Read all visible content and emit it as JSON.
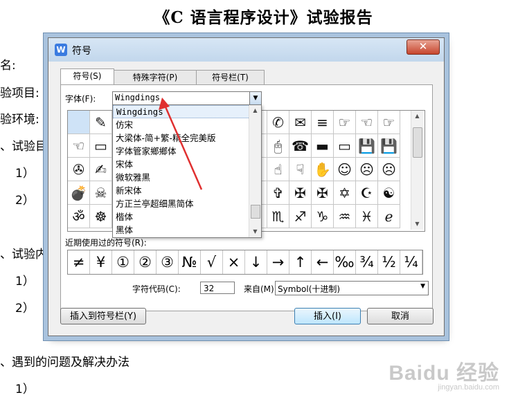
{
  "document": {
    "title": "《C 语言程序设计》试验报告",
    "lines": [
      "名:",
      "验项目:",
      "验环境:",
      "、试验目",
      "1）",
      "2）",
      "、试验内",
      "1）",
      "2）",
      "、遇到的问题及解决办法",
      "1）"
    ]
  },
  "watermark": {
    "main": "Baidu 经验",
    "sub": "jingyan.baidu.com"
  },
  "dialog": {
    "app_icon": "W",
    "title": "符号",
    "close_label": "✕",
    "tabs": [
      "符号(S)",
      "特殊字符(P)",
      "符号栏(T)"
    ],
    "font_label": "字体(F):",
    "font_value": "Wingdings",
    "font_options": [
      "Wingdings",
      "仿宋",
      "大梁体-简+繁-精全完美版",
      "字体管家鄉鄉体",
      "宋体",
      "微软雅黑",
      "新宋体",
      "方正兰亭超细黑简体",
      "楷体",
      "黑体"
    ],
    "symbol_rows": [
      [
        "",
        "✎",
        "",
        "",
        "",
        "",
        "",
        "",
        "",
        "✆",
        "✉",
        "≡",
        "☞",
        "☜",
        "☞"
      ],
      [
        "☜",
        "▭",
        "",
        "",
        "",
        "",
        "",
        "",
        "",
        "🖰",
        "☎",
        "▬",
        "▭",
        "💾",
        "💾"
      ],
      [
        "✇",
        "✍",
        "",
        "",
        "",
        "",
        "",
        "",
        "",
        "☝",
        "☟",
        "✋",
        "☺",
        "☹",
        "☹"
      ],
      [
        "💣",
        "☠",
        "",
        "",
        "",
        "",
        "",
        "",
        "",
        "✞",
        "✠",
        "✠",
        "✡",
        "☪",
        "☯"
      ],
      [
        "ॐ",
        "☸",
        "",
        "",
        "",
        "",
        "",
        "",
        "",
        "♏",
        "♐",
        "♑",
        "♒",
        "♓",
        "ℯ"
      ]
    ],
    "recent_label": "近期使用过的符号(R):",
    "recent_symbols": [
      "≠",
      "¥",
      "①",
      "②",
      "③",
      "№",
      "√",
      "×",
      "↓",
      "→",
      "↑",
      "←",
      "‰",
      "¾",
      "½",
      "¼"
    ],
    "char_code_label": "字符代码(C):",
    "char_code_value": "32",
    "from_label": "来自(M)",
    "from_value": "Symbol(十进制)",
    "insert_to_bar_label": "插入到符号栏(Y)",
    "insert_label": "插入(I)",
    "cancel_label": "取消"
  },
  "colors": {
    "annotation_arrow": "#e03030",
    "selection": "#cfe3f7",
    "title_bar": "#c9dcef"
  }
}
